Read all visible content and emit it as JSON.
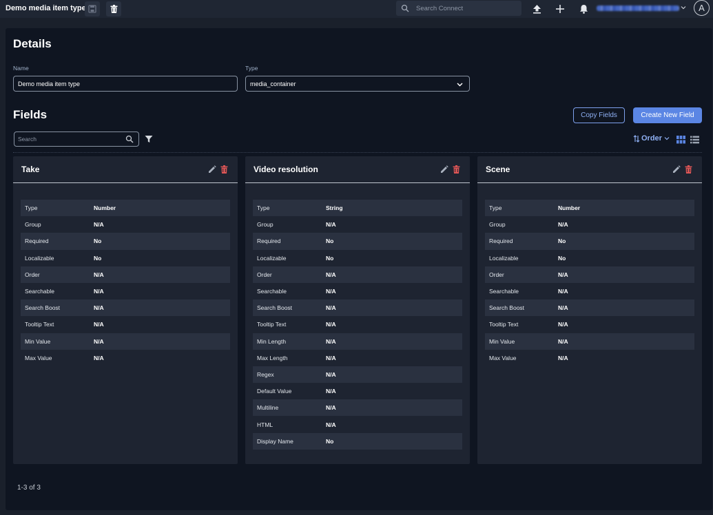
{
  "topbar": {
    "title": "Demo media item type",
    "search_placeholder": "Search Connect",
    "avatar_letter": "A"
  },
  "details": {
    "heading": "Details",
    "name_label": "Name",
    "name_value": "Demo media item type",
    "type_label": "Type",
    "type_value": "media_container"
  },
  "fields": {
    "heading": "Fields",
    "copy_label": "Copy Fields",
    "create_label": "Create New Field",
    "search_placeholder": "Search",
    "order_label": "Order"
  },
  "cards": [
    {
      "title": "Take",
      "rows": [
        {
          "k": "Type",
          "v": "Number"
        },
        {
          "k": "Group",
          "v": "N/A"
        },
        {
          "k": "Required",
          "v": "No"
        },
        {
          "k": "Localizable",
          "v": "No"
        },
        {
          "k": "Order",
          "v": "N/A"
        },
        {
          "k": "Searchable",
          "v": "N/A"
        },
        {
          "k": "Search Boost",
          "v": "N/A"
        },
        {
          "k": "Tooltip Text",
          "v": "N/A"
        },
        {
          "k": "Min Value",
          "v": "N/A"
        },
        {
          "k": "Max Value",
          "v": "N/A"
        }
      ]
    },
    {
      "title": "Video resolution",
      "rows": [
        {
          "k": "Type",
          "v": "String"
        },
        {
          "k": "Group",
          "v": "N/A"
        },
        {
          "k": "Required",
          "v": "No"
        },
        {
          "k": "Localizable",
          "v": "No"
        },
        {
          "k": "Order",
          "v": "N/A"
        },
        {
          "k": "Searchable",
          "v": "N/A"
        },
        {
          "k": "Search Boost",
          "v": "N/A"
        },
        {
          "k": "Tooltip Text",
          "v": "N/A"
        },
        {
          "k": "Min Length",
          "v": "N/A"
        },
        {
          "k": "Max Length",
          "v": "N/A"
        },
        {
          "k": "Regex",
          "v": "N/A"
        },
        {
          "k": "Default Value",
          "v": "N/A"
        },
        {
          "k": "Multiline",
          "v": "N/A"
        },
        {
          "k": "HTML",
          "v": "N/A"
        },
        {
          "k": "Display Name",
          "v": "No"
        }
      ]
    },
    {
      "title": "Scene",
      "rows": [
        {
          "k": "Type",
          "v": "Number"
        },
        {
          "k": "Group",
          "v": "N/A"
        },
        {
          "k": "Required",
          "v": "No"
        },
        {
          "k": "Localizable",
          "v": "No"
        },
        {
          "k": "Order",
          "v": "N/A"
        },
        {
          "k": "Searchable",
          "v": "N/A"
        },
        {
          "k": "Search Boost",
          "v": "N/A"
        },
        {
          "k": "Tooltip Text",
          "v": "N/A"
        },
        {
          "k": "Min Value",
          "v": "N/A"
        },
        {
          "k": "Max Value",
          "v": "N/A"
        }
      ]
    }
  ],
  "pager": {
    "text": "1-3 of 3"
  },
  "colors": {
    "accent": "#5b86e4",
    "danger": "#e05656",
    "panel": "#0f1521",
    "card": "#1e2431"
  }
}
